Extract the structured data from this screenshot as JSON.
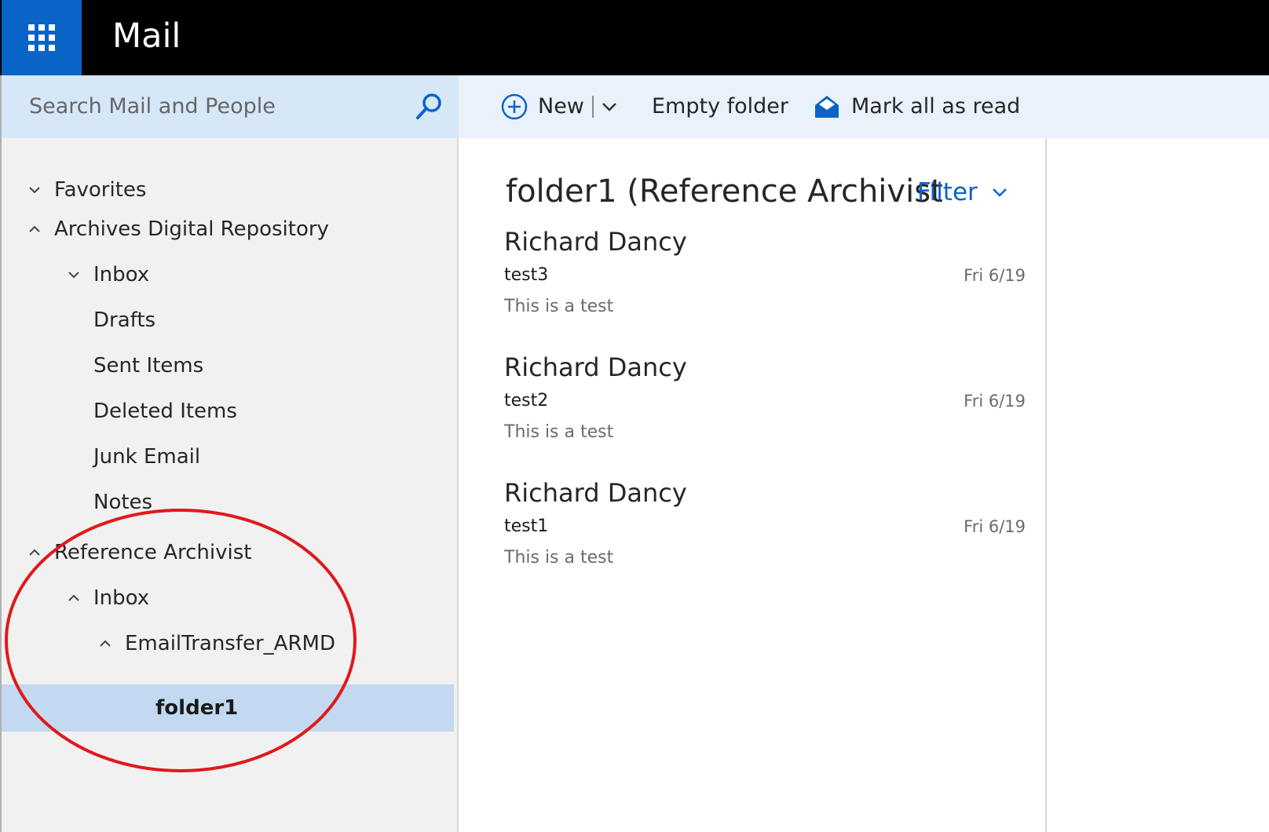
{
  "app": {
    "title": "Mail",
    "launcher_icon": "app-launcher-grid-icon"
  },
  "search": {
    "placeholder": "Search Mail and People",
    "icon": "search-icon"
  },
  "toolbar": {
    "new_label": "New",
    "empty_folder_label": "Empty folder",
    "mark_all_read_label": "Mark all as read",
    "accent_color": "#0a64c8"
  },
  "sidebar": {
    "items": [
      {
        "label": "Favorites",
        "state": "collapsed",
        "level": 0
      },
      {
        "label": "Archives Digital Repository",
        "state": "expanded",
        "level": 0
      },
      {
        "label": "Inbox",
        "state": "collapsed",
        "level": 1
      },
      {
        "label": "Drafts",
        "state": "none",
        "level": 1
      },
      {
        "label": "Sent Items",
        "state": "none",
        "level": 1
      },
      {
        "label": "Deleted Items",
        "state": "none",
        "level": 1
      },
      {
        "label": "Junk Email",
        "state": "none",
        "level": 1
      },
      {
        "label": "Notes",
        "state": "none",
        "level": 1
      },
      {
        "label": "Reference Archivist",
        "state": "expanded",
        "level": 0
      },
      {
        "label": "Inbox",
        "state": "expanded",
        "level": 1
      },
      {
        "label": "EmailTransfer_ARMD",
        "state": "expanded",
        "level": 2
      },
      {
        "label": "folder1",
        "state": "selected",
        "level": 3
      }
    ],
    "selected_color": "#c2d9f1"
  },
  "list": {
    "folder_title": "folder1 (Reference Archivist",
    "filter_label": "Filter",
    "messages": [
      {
        "sender": "Richard Dancy",
        "subject": "test3",
        "date": "Fri 6/19",
        "preview": "This is a test"
      },
      {
        "sender": "Richard Dancy",
        "subject": "test2",
        "date": "Fri 6/19",
        "preview": "This is a test"
      },
      {
        "sender": "Richard Dancy",
        "subject": "test1",
        "date": "Fri 6/19",
        "preview": "This is a test"
      }
    ]
  },
  "annotation": {
    "shape": "ellipse",
    "color": "#e0191b"
  }
}
